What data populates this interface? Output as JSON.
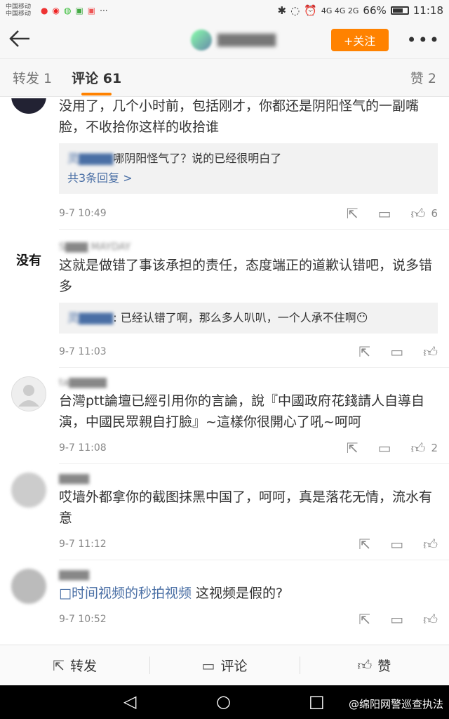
{
  "status": {
    "carrier1": "中国移动",
    "carrier2": "中国移动",
    "network": "4G  4G  2G",
    "battery": "66%",
    "time": "11:18",
    "battery_level": 0.66
  },
  "header": {
    "back_icon": "arrow-left-icon",
    "follow_label": "+关注",
    "more_label": "•••",
    "accent_color": "#ff8200"
  },
  "tabs": {
    "repost": "转发 1",
    "comments": "评论 61",
    "likes": "赞 2"
  },
  "comments": [
    {
      "name": "",
      "text": "没用了，几个小时前，包括刚才，你都还是阴阳怪气的一副嘴脸，不收拾你这样的收拾谁",
      "reply_name": "灵▇▇▇▇",
      "reply_text": "哪阴阳怪气了？说的已经很明白了",
      "reply_more": "共3条回复 >",
      "time": "9-7 10:49",
      "likes": "6"
    },
    {
      "avatar_text": "没有",
      "name": "S▇▇▇ MAYDAY",
      "text": "这就是做错了事该承担的责任，态度端正的道歉认错吧，说多错多",
      "reply_name": "灵▇▇▇▇",
      "reply_text": ": 已经认错了啊，那么多人叭叭，一个人承不住啊😶",
      "time": "9-7 11:03",
      "likes": ""
    },
    {
      "name": "ta▇▇▇▇▇",
      "text": "台灣ptt論壇已經引用你的言論，說『中國政府花錢請人自導自演，中國民眾親自打臉』~這樣你很開心了吼~呵呵",
      "time": "9-7 11:08",
      "likes": "2"
    },
    {
      "name": "▇▇▇▇",
      "text": "哎墙外都拿你的截图抹黑中国了，呵呵，真是落花无情，流水有意",
      "time": "9-7 11:12",
      "likes": ""
    },
    {
      "name": "▇▇▇▇",
      "link": "□时间视频的秒拍视频",
      "text": " 这视频是假的?",
      "time": "9-7 10:52",
      "likes": ""
    }
  ],
  "actions": {
    "repost": "转发",
    "comment": "评论",
    "like": "赞"
  },
  "watermark": "@绵阳网警巡查执法"
}
